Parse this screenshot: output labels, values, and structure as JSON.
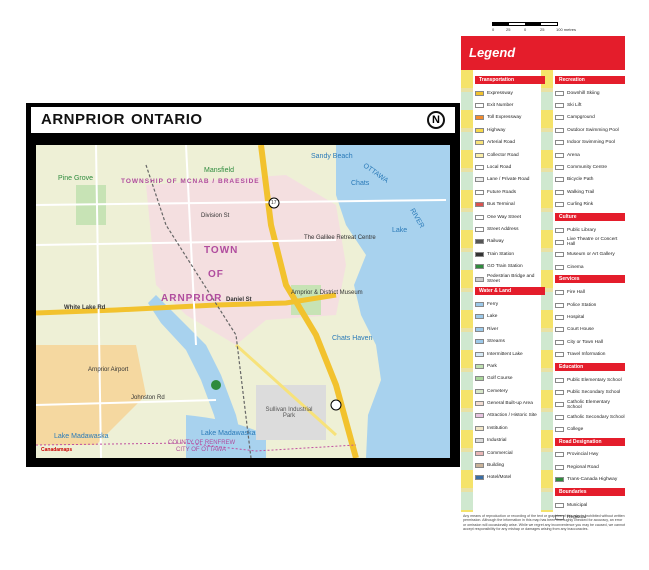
{
  "map": {
    "title_main": "ARNPRIOR",
    "title_sub": "ONTARIO",
    "labels": {
      "pine_grove": "Pine Grove",
      "mansfield": "Mansfield",
      "township": "TOWNSHIP OF MCNAB / BRAESIDE",
      "town": "TOWN",
      "of": "OF",
      "arnprior": "ARNPRIOR",
      "sandy_beach": "Sandy Beach",
      "ottawa": "OTTAWA",
      "river": "RIVER",
      "chats": "Chats",
      "lake": "Lake",
      "chats_haven": "Chats Haven",
      "arnprior_airport": "Arnprior Airport",
      "lake_madawaska": "Lake Madawaska",
      "lake_madawaska_2": "Lake Madawaska",
      "sullivan": "Sullivan Industrial Park",
      "county": "COUNTY OF RENFREW",
      "city_ottawa": "CITY OF OTTAWA",
      "white_lake_rd": "White Lake Rd",
      "daniel_st": "Daniel St",
      "campbell": "Campbell Dr",
      "division": "Division St",
      "madawaska": "Madawaska St",
      "river_rd": "River Rd",
      "mcgonigal": "McGonigal St",
      "galilee": "The Galilee Retreat Centre",
      "arnprior_museum": "Arnprior & District Museum",
      "johnston": "Johnston Rd",
      "hwy_17": "17",
      "hwy_29": "29"
    },
    "watermark": "Canadamaps"
  },
  "scale": {
    "labels": [
      "0",
      "25",
      "0",
      "25",
      "100 metres"
    ]
  },
  "legend": {
    "title": "Legend",
    "col1": [
      {
        "section": "Transportation",
        "items": [
          {
            "label": "Expressway",
            "color": "#f2c22e"
          },
          {
            "label": "Exit Number",
            "color": "#ffffff"
          },
          {
            "label": "Toll Expressway",
            "color": "#f28b2e"
          },
          {
            "label": "Highway",
            "color": "#f7d94a"
          },
          {
            "label": "Arterial Road",
            "color": "#f7e27a"
          },
          {
            "label": "Collector Road",
            "color": "#fbeea8"
          },
          {
            "label": "Local Road",
            "color": "#ffffff"
          },
          {
            "label": "Lane / Private Road",
            "color": "#eeeeee"
          },
          {
            "label": "Future Roads",
            "color": "#ffffff"
          },
          {
            "label": "Bus Terminal",
            "color": "#d9534f"
          },
          {
            "label": "One Way Street",
            "color": "#ffffff"
          },
          {
            "label": "Street Address",
            "color": "#ffffff"
          },
          {
            "label": "Railway",
            "color": "#555555"
          },
          {
            "label": "Train Station",
            "color": "#333333"
          },
          {
            "label": "GO Train Station",
            "color": "#2e8b3d"
          },
          {
            "label": "Pedestrian Bridge and Street",
            "color": "#cccccc"
          }
        ]
      },
      {
        "section": "Water & Land",
        "items": [
          {
            "label": "Ferry",
            "color": "#9cc9ea"
          },
          {
            "label": "Lake",
            "color": "#9cc9ea"
          },
          {
            "label": "River",
            "color": "#9cc9ea"
          },
          {
            "label": "Streams",
            "color": "#9cc9ea"
          },
          {
            "label": "Intermittent Lake",
            "color": "#d6e9f5"
          },
          {
            "label": "Park",
            "color": "#bfe0b0"
          },
          {
            "label": "Golf Course",
            "color": "#a9d79a"
          },
          {
            "label": "Cemetery",
            "color": "#d7e6c8"
          },
          {
            "label": "General Built-up Area",
            "color": "#f2dcd2"
          },
          {
            "label": "Attraction / Historic Site",
            "color": "#e7c4e0"
          },
          {
            "label": "Institution",
            "color": "#f1e6c6"
          },
          {
            "label": "Industrial",
            "color": "#dcdcdc"
          },
          {
            "label": "Commercial",
            "color": "#e9b7b7"
          },
          {
            "label": "Building",
            "color": "#c9b39a"
          },
          {
            "label": "Hotel/Motel",
            "color": "#3a6ea5"
          }
        ]
      }
    ],
    "col2": [
      {
        "section": "Recreation",
        "items": [
          {
            "label": "Downhill Skiing",
            "color": "#ffffff"
          },
          {
            "label": "Ski Lift",
            "color": "#ffffff"
          },
          {
            "label": "Campground",
            "color": "#ffffff"
          },
          {
            "label": "Outdoor Swimming Pool",
            "color": "#ffffff"
          },
          {
            "label": "Indoor Swimming Pool",
            "color": "#ffffff"
          },
          {
            "label": "Arena",
            "color": "#ffffff"
          },
          {
            "label": "Community Centre",
            "color": "#ffffff"
          },
          {
            "label": "Bicycle Path",
            "color": "#ffffff"
          },
          {
            "label": "Walking Trail",
            "color": "#ffffff"
          },
          {
            "label": "Curling Rink",
            "color": "#ffffff"
          }
        ]
      },
      {
        "section": "Culture",
        "items": [
          {
            "label": "Public Library",
            "color": "#ffffff"
          },
          {
            "label": "Live Theatre or Concert Hall",
            "color": "#ffffff"
          },
          {
            "label": "Museum or Art Gallery",
            "color": "#ffffff"
          },
          {
            "label": "Cinema",
            "color": "#ffffff"
          }
        ]
      },
      {
        "section": "Services",
        "items": [
          {
            "label": "Fire Hall",
            "color": "#ffffff"
          },
          {
            "label": "Police Station",
            "color": "#ffffff"
          },
          {
            "label": "Hospital",
            "color": "#ffffff"
          },
          {
            "label": "Court House",
            "color": "#ffffff"
          },
          {
            "label": "City or Town Hall",
            "color": "#ffffff"
          },
          {
            "label": "Travel Information",
            "color": "#ffffff"
          }
        ]
      },
      {
        "section": "Education",
        "items": [
          {
            "label": "Public Elementary School",
            "color": "#ffffff"
          },
          {
            "label": "Public Secondary School",
            "color": "#ffffff"
          },
          {
            "label": "Catholic Elementary School",
            "color": "#ffffff"
          },
          {
            "label": "Catholic Secondary School",
            "color": "#ffffff"
          },
          {
            "label": "College",
            "color": "#ffffff"
          }
        ]
      },
      {
        "section": "Road Designation",
        "items": [
          {
            "label": "Provincial Hwy",
            "color": "#ffffff"
          },
          {
            "label": "Regional Road",
            "color": "#ffffff"
          },
          {
            "label": "Trans-Canada Highway",
            "color": "#2e8b3d"
          }
        ]
      },
      {
        "section": "Boundaries",
        "items": [
          {
            "label": "Municipal",
            "color": "#ffffff"
          },
          {
            "label": "Regional",
            "color": "#ffffff"
          }
        ]
      }
    ]
  },
  "disclaimer": "Any means of reproduction or recording of the text or graphics of this map is prohibited without written permission. Although the information in this map has been thoroughly checked for accuracy, an error or omission will occasionally arise. While we regret any inconvenience you may be caused, we cannot accept responsibility for any mishap or damages arising from any inaccuracies."
}
